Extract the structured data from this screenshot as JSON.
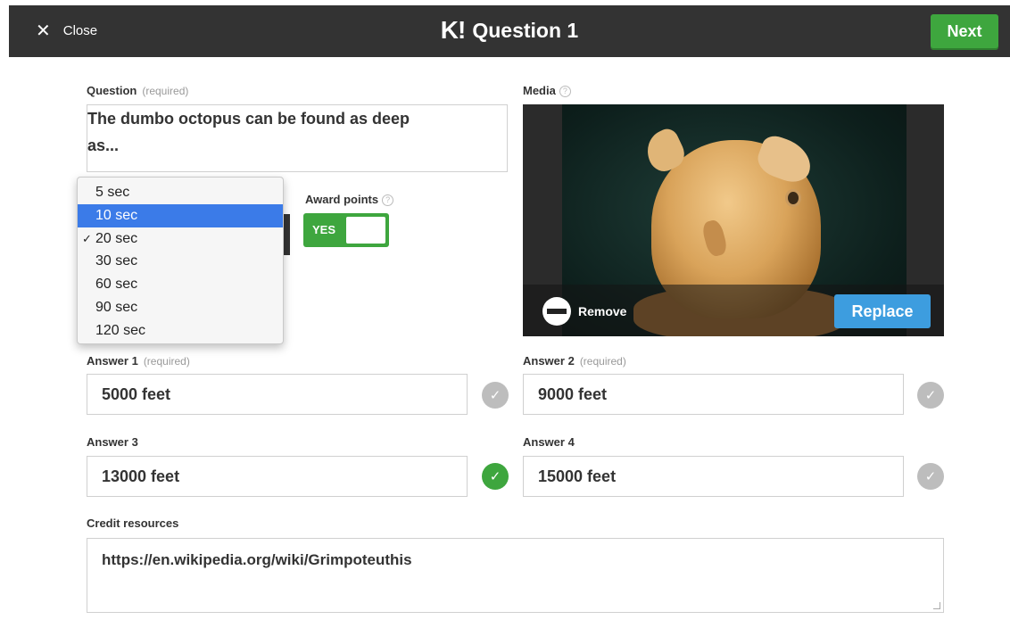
{
  "header": {
    "close_label": "Close",
    "logo": "K!",
    "title": "Question 1",
    "next_label": "Next",
    "bar_color": "#333333",
    "next_color": "#3ea63e"
  },
  "question": {
    "label": "Question",
    "required": "(required)",
    "value": "The dumbo octopus can be found as deep as..."
  },
  "time_limit": {
    "options": [
      "5 sec",
      "10 sec",
      "20 sec",
      "30 sec",
      "60 sec",
      "90 sec",
      "120 sec"
    ],
    "selected": "20 sec",
    "highlighted": "10 sec"
  },
  "award_points": {
    "label": "Award points",
    "toggle_label": "YES",
    "on": true
  },
  "media": {
    "label": "Media",
    "remove_label": "Remove",
    "replace_label": "Replace"
  },
  "answers": [
    {
      "label": "Answer 1",
      "required": "(required)",
      "value": "5000 feet",
      "correct": false
    },
    {
      "label": "Answer 2",
      "required": "(required)",
      "value": "9000 feet",
      "correct": false
    },
    {
      "label": "Answer 3",
      "required": "",
      "value": "13000 feet",
      "correct": true
    },
    {
      "label": "Answer 4",
      "required": "",
      "value": "15000 feet",
      "correct": false
    }
  ],
  "credit": {
    "label": "Credit resources",
    "value": "https://en.wikipedia.org/wiki/Grimpoteuthis"
  }
}
